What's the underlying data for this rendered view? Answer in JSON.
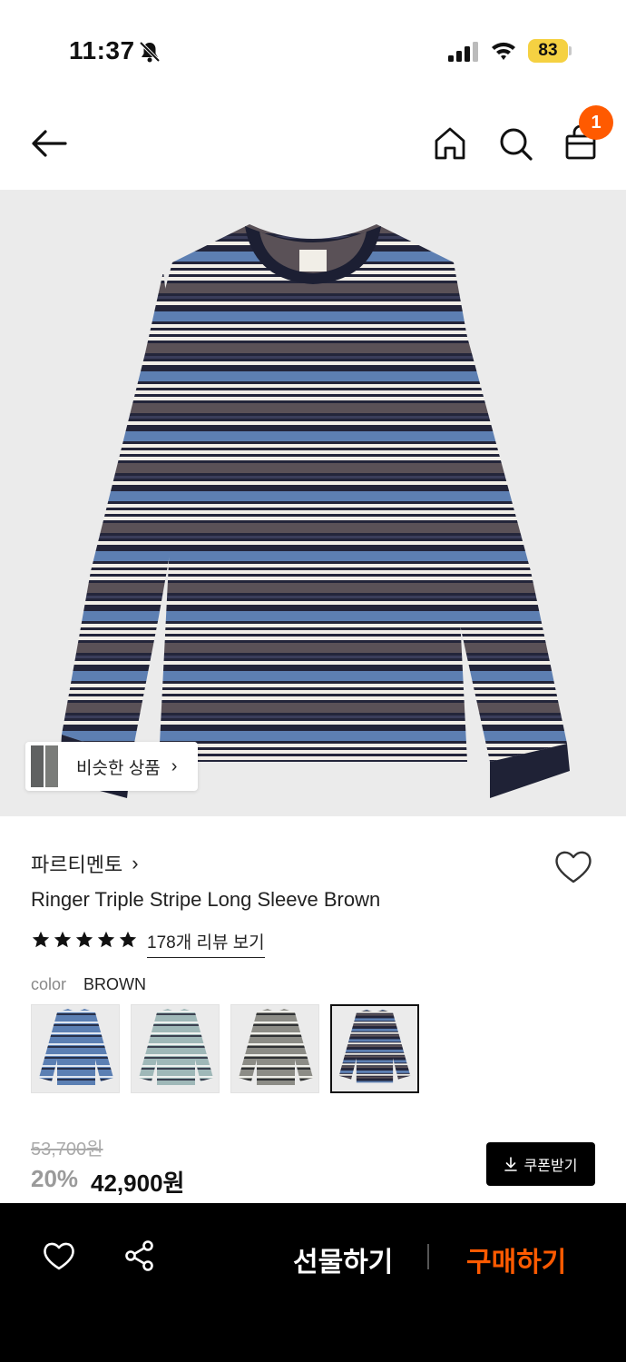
{
  "status_bar": {
    "time": "11:37",
    "battery": "83"
  },
  "nav": {
    "cart_count": "1"
  },
  "hero": {
    "similar_button_label": "비슷한 상품"
  },
  "product": {
    "brand": "파르티멘토",
    "title": "Ringer Triple Stripe Long Sleeve Brown",
    "rating_stars": 5,
    "review_link": "178개 리뷰 보기",
    "color_label": "color",
    "color_value": "BROWN",
    "swatches": [
      {
        "name": "blue",
        "color": "#5b7fb3"
      },
      {
        "name": "mint",
        "color": "#9fb8b8"
      },
      {
        "name": "grey",
        "color": "#8c8c86"
      },
      {
        "name": "brown",
        "color": "#3e3f4a",
        "selected": true
      }
    ],
    "original_price": "53,700원",
    "discount": "20%",
    "price": "42,900원",
    "coupon_button": "쿠폰받기"
  },
  "bottom_bar": {
    "gift_label": "선물하기",
    "buy_label": "구매하기"
  },
  "colors": {
    "accent": "#ff5a00",
    "badge": "#ff5a00",
    "battery": "#f5d142"
  }
}
